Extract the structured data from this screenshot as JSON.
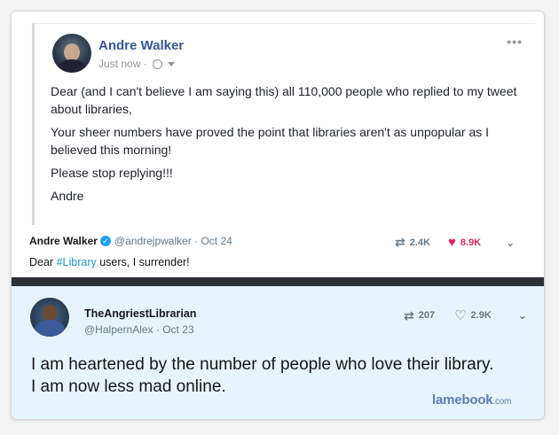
{
  "facebook_post": {
    "author": "Andre Walker",
    "timestamp": "Just now ·",
    "more_label": "•••",
    "paragraphs": [
      "Dear (and I can't believe I am saying this) all 110,000 people who replied to my tweet about libraries,",
      "Your sheer numbers have proved the point that libraries aren't as unpopular as I believed this morning!",
      "Please stop replying!!!",
      "Andre"
    ],
    "icons": [
      "globe-icon",
      "caret-down-icon",
      "more-options-icon"
    ]
  },
  "tweet_1": {
    "name": "Andre Walker",
    "handle_date": "@andrejpwalker · Oct 24",
    "body_prefix": "Dear ",
    "hashtag": "#Library",
    "body_suffix": " users, I surrender!",
    "retweets": "2.4K",
    "likes": "8.9K",
    "icons": [
      "verified-icon",
      "retweet-icon",
      "heart-filled-icon",
      "chevron-down-icon"
    ],
    "colors": {
      "hashtag": "#1b95e0",
      "liked": "#e0245e"
    }
  },
  "tweet_2": {
    "name": "TheAngriestLibrarian",
    "handle_date": "@HalpernAlex · Oct 23",
    "body_line1": "I am heartened by the number of people who love their library.",
    "body_line2": "I am now less mad online.",
    "retweets": "207",
    "likes": "2.9K",
    "icons": [
      "retweet-icon",
      "heart-outline-icon",
      "chevron-down-icon"
    ]
  },
  "watermark": {
    "brand": "lamebook",
    "suffix": ".com"
  }
}
